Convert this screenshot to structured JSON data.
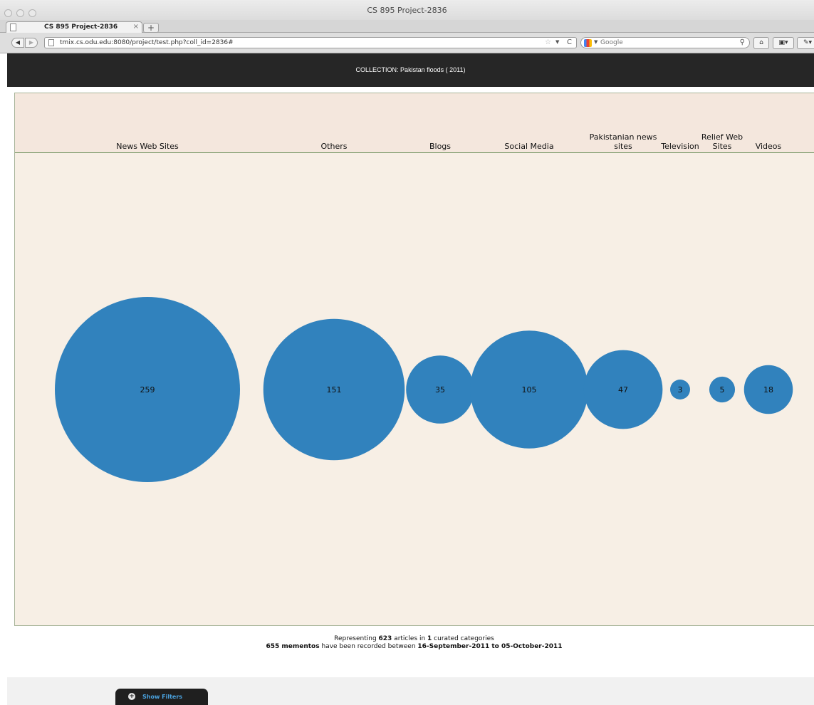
{
  "window": {
    "title": "CS 895 Project-2836"
  },
  "tabs": [
    {
      "label": "CS 895 Project-2836",
      "close": "×"
    }
  ],
  "new_tab_label": "+",
  "nav": {
    "back": "◀",
    "forward": "▶",
    "url": "tmix.cs.odu.edu:8080/project/test.php?coll_id=2836#",
    "bookmark_star": "☆",
    "url_dropdown": "▼",
    "reload": "C",
    "search_engine_dropdown": "▼",
    "search_placeholder": "Google",
    "search_icon": "⚲",
    "home": "⌂",
    "toolbar_button_1": "▣▾",
    "toolbar_button_2": "✎▾"
  },
  "page": {
    "collection_title": "COLLECTION: Pakistan floods ( 2011)",
    "summary": {
      "line1_prefix": "Representing ",
      "articles": "623",
      "line1_mid": " articles in ",
      "categories_count": "1",
      "line1_suffix": " curated categories",
      "mementos": "655 mementos",
      "line2_mid": " have been recorded between ",
      "start_date": "16-September-2011",
      "line2_to": " to ",
      "end_date": "05-October-2011"
    },
    "filters": {
      "icon": "+",
      "label": "Show Filters"
    }
  },
  "chart_data": {
    "type": "bubble",
    "bubble_color": "#3182bd",
    "categories": [
      {
        "name": "News Web Sites",
        "label_lines": [
          "News Web Sites"
        ],
        "count": 259
      },
      {
        "name": "Others",
        "label_lines": [
          "Others"
        ],
        "count": 151
      },
      {
        "name": "Blogs",
        "label_lines": [
          "Blogs"
        ],
        "count": 35
      },
      {
        "name": "Social Media",
        "label_lines": [
          "Social Media"
        ],
        "count": 105
      },
      {
        "name": "Pakistanian news sites",
        "label_lines": [
          "Pakistanian news",
          "sites"
        ],
        "count": 47
      },
      {
        "name": "Television",
        "label_lines": [
          "Television"
        ],
        "count": 3
      },
      {
        "name": "Relief Web Sites",
        "label_lines": [
          "Relief Web",
          "Sites"
        ],
        "count": 5
      },
      {
        "name": "Videos",
        "label_lines": [
          "Videos"
        ],
        "count": 18
      }
    ]
  }
}
